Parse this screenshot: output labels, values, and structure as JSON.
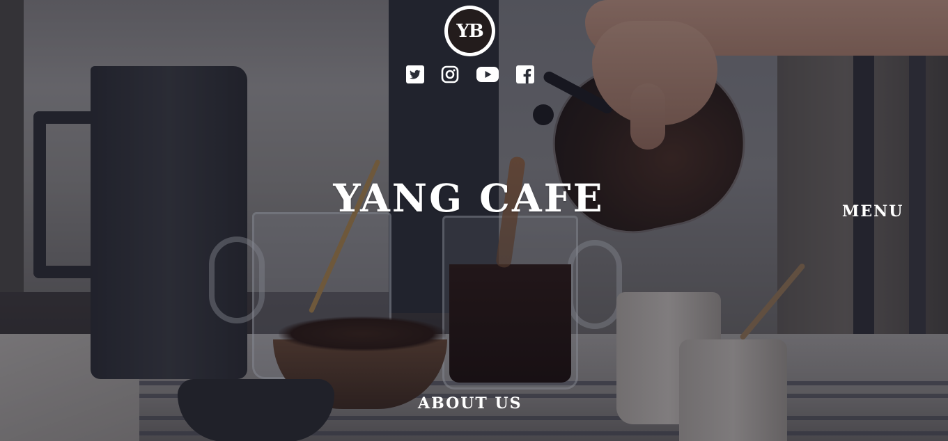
{
  "logo": {
    "text": "YB"
  },
  "socials": [
    {
      "name": "twitter-icon"
    },
    {
      "name": "instagram-icon"
    },
    {
      "name": "youtube-icon"
    },
    {
      "name": "facebook-icon"
    }
  ],
  "hero": {
    "title": "YANG CAFE"
  },
  "nav": {
    "menu_label": "MENU",
    "about_label": "ABOUT US"
  },
  "colors": {
    "text": "#ffffff",
    "logo_bg": "#231c1c",
    "overlay": "#121422"
  }
}
